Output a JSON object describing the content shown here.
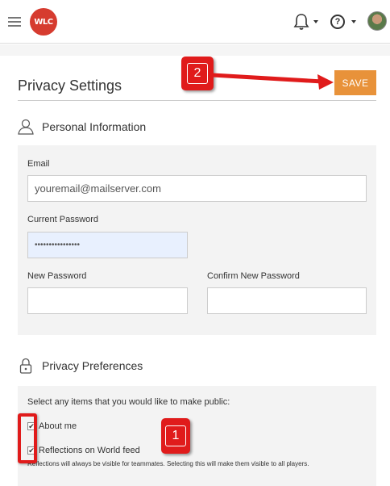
{
  "header": {
    "logo_text": "WLC",
    "help_glyph": "?"
  },
  "page": {
    "title": "Privacy Settings",
    "save_label": "SAVE"
  },
  "personal": {
    "heading": "Personal Information",
    "email_label": "Email",
    "email_value": "youremail@mailserver.com",
    "current_password_label": "Current Password",
    "current_password_value": "••••••••••••••••",
    "new_password_label": "New Password",
    "confirm_password_label": "Confirm New Password"
  },
  "privacy": {
    "heading": "Privacy Preferences",
    "intro": "Select any items that you would like to make public:",
    "items": [
      {
        "label": "About me",
        "checked": true
      },
      {
        "label": "Reflections on World feed",
        "checked": true
      }
    ],
    "note": "Reflections will always be visible for teammates. Selecting this will make them visible to all players."
  },
  "annotations": {
    "one": "1",
    "two": "2",
    "color": "#e01b1b"
  },
  "colors": {
    "accent": "#e8923a",
    "logo": "#d63b2f"
  },
  "icons": [
    "menu-icon",
    "bell-icon",
    "help-icon",
    "user-icon",
    "lock-icon",
    "checkbox-icon"
  ]
}
